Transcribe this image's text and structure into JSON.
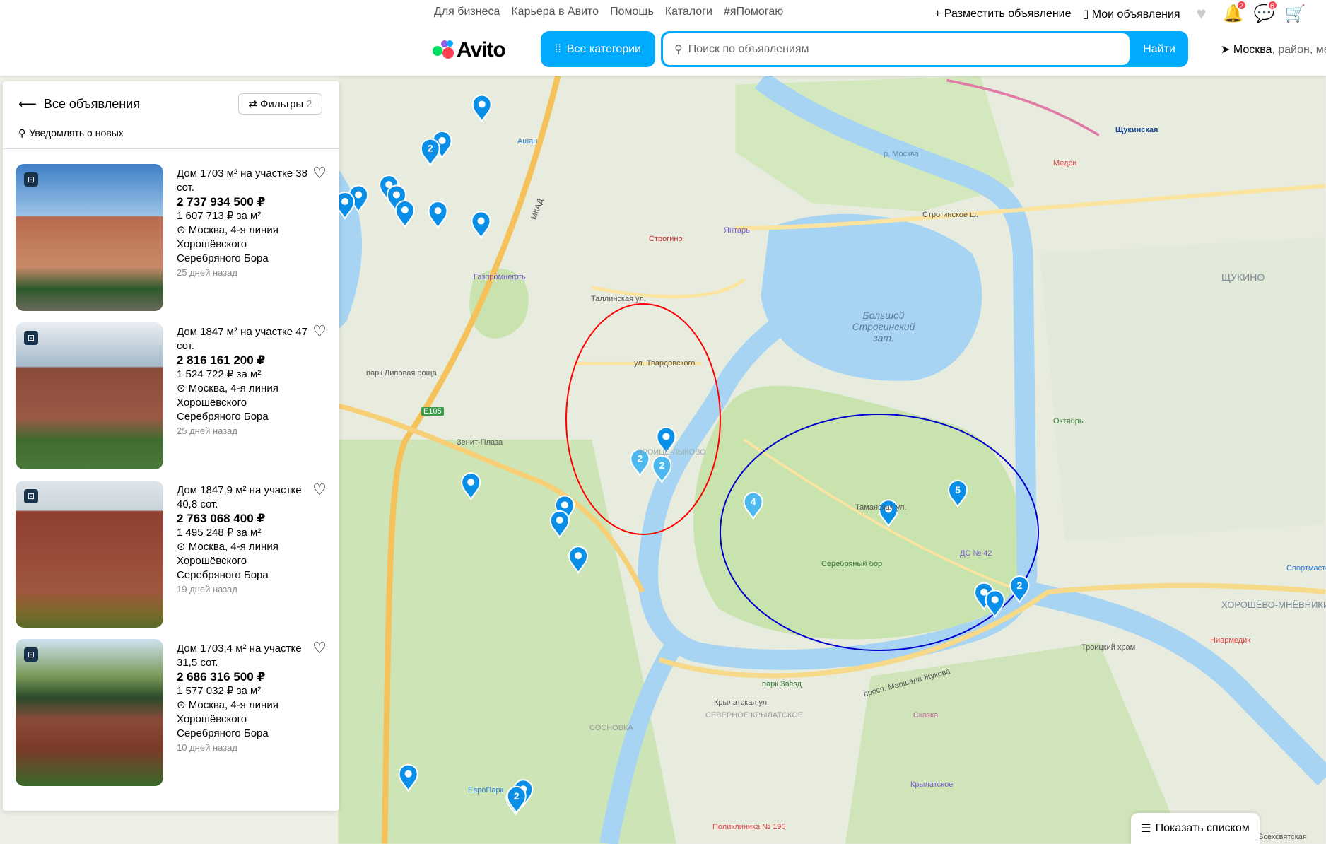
{
  "header": {
    "top_links": [
      "Для бизнеса",
      "Карьера в Авито",
      "Помощь",
      "Каталоги",
      "#яПомогаю"
    ],
    "post_ad": "Разместить объявление",
    "my_ads": "Мои объявления",
    "notifications_count": "2",
    "messages_count": "6",
    "logo": "Avito",
    "categories": "Все категории",
    "search_placeholder": "Поиск по объявлениям",
    "search_button": "Найти",
    "location_city": "Москва",
    "location_rest": ", район, ме"
  },
  "panel": {
    "back": "Все объявления",
    "filters": "Фильтры",
    "filters_count": "2",
    "notify": "Уведомлять о новых",
    "listings": [
      {
        "title": "Дом 1703 м² на участке 38 сот.",
        "price": "2 737 934 500 ₽",
        "per_m2": "1 607 713 ₽ за м²",
        "address": "Москва, 4-я линия Хорошёвского Серебряного Бора",
        "ago": "25 дней назад"
      },
      {
        "title": "Дом 1847 м² на участке 47 сот.",
        "price": "2 816 161 200 ₽",
        "per_m2": "1 524 722 ₽ за м²",
        "address": "Москва, 4-я линия Хорошёвского Серебряного Бора",
        "ago": "25 дней назад"
      },
      {
        "title": "Дом 1847,9 м² на участке 40,8 сот.",
        "price": "2 763 068 400 ₽",
        "per_m2": "1 495 248 ₽ за м²",
        "address": "Москва, 4-я линия Хорошёвского Серебряного Бора",
        "ago": "19 дней назад"
      },
      {
        "title": "Дом 1703,4 м² на участке 31,5 сот.",
        "price": "2 686 316 500 ₽",
        "per_m2": "1 577 032 ₽ за м²",
        "address": "Москва, 4-я линия Хорошёвского Серебряного Бора",
        "ago": "10 дней назад"
      }
    ]
  },
  "map": {
    "labels": [
      "Строгино",
      "Янтарь",
      "Большой Строгинский зат.",
      "Серебряный бор",
      "Щукинская",
      "ЩУКИНО",
      "Медси",
      "ул. Твардовского",
      "Таллинская ул.",
      "Строгинское ш.",
      "Таманская ул.",
      "МКАД",
      "парк Липовая роща",
      "Зенит-Плаза",
      "ТРОИЦЕ-ЛЫКОВО",
      "ДС № 42",
      "Октябрь",
      "ХОРОШЁВО-МНЁВНИКИ",
      "просп. Маршала Жукова",
      "парк Звёзд",
      "Крылатская ул.",
      "ЕвроПарк",
      "Газпромнефть",
      "Ашан",
      "р. Москва",
      "Троицкий храм",
      "Сказка",
      "Крылатское",
      "Ниармедик",
      "Поликлиника № 195",
      "Всехсвятская",
      "Спортмастер",
      "СЕВЕРНОЕ КРЫЛАТСКОЕ",
      "СОСНОВКА",
      "E105"
    ],
    "clusters": [
      "2",
      "2",
      "2",
      "4",
      "5",
      "2",
      "2"
    ]
  },
  "show_list": "Показать списком",
  "colors": {
    "accent": "#00aaff",
    "red_circle": "#ff0000",
    "blue_circle": "#0000cc",
    "water": "#a6d4f2",
    "green": "#cfe6b8"
  }
}
